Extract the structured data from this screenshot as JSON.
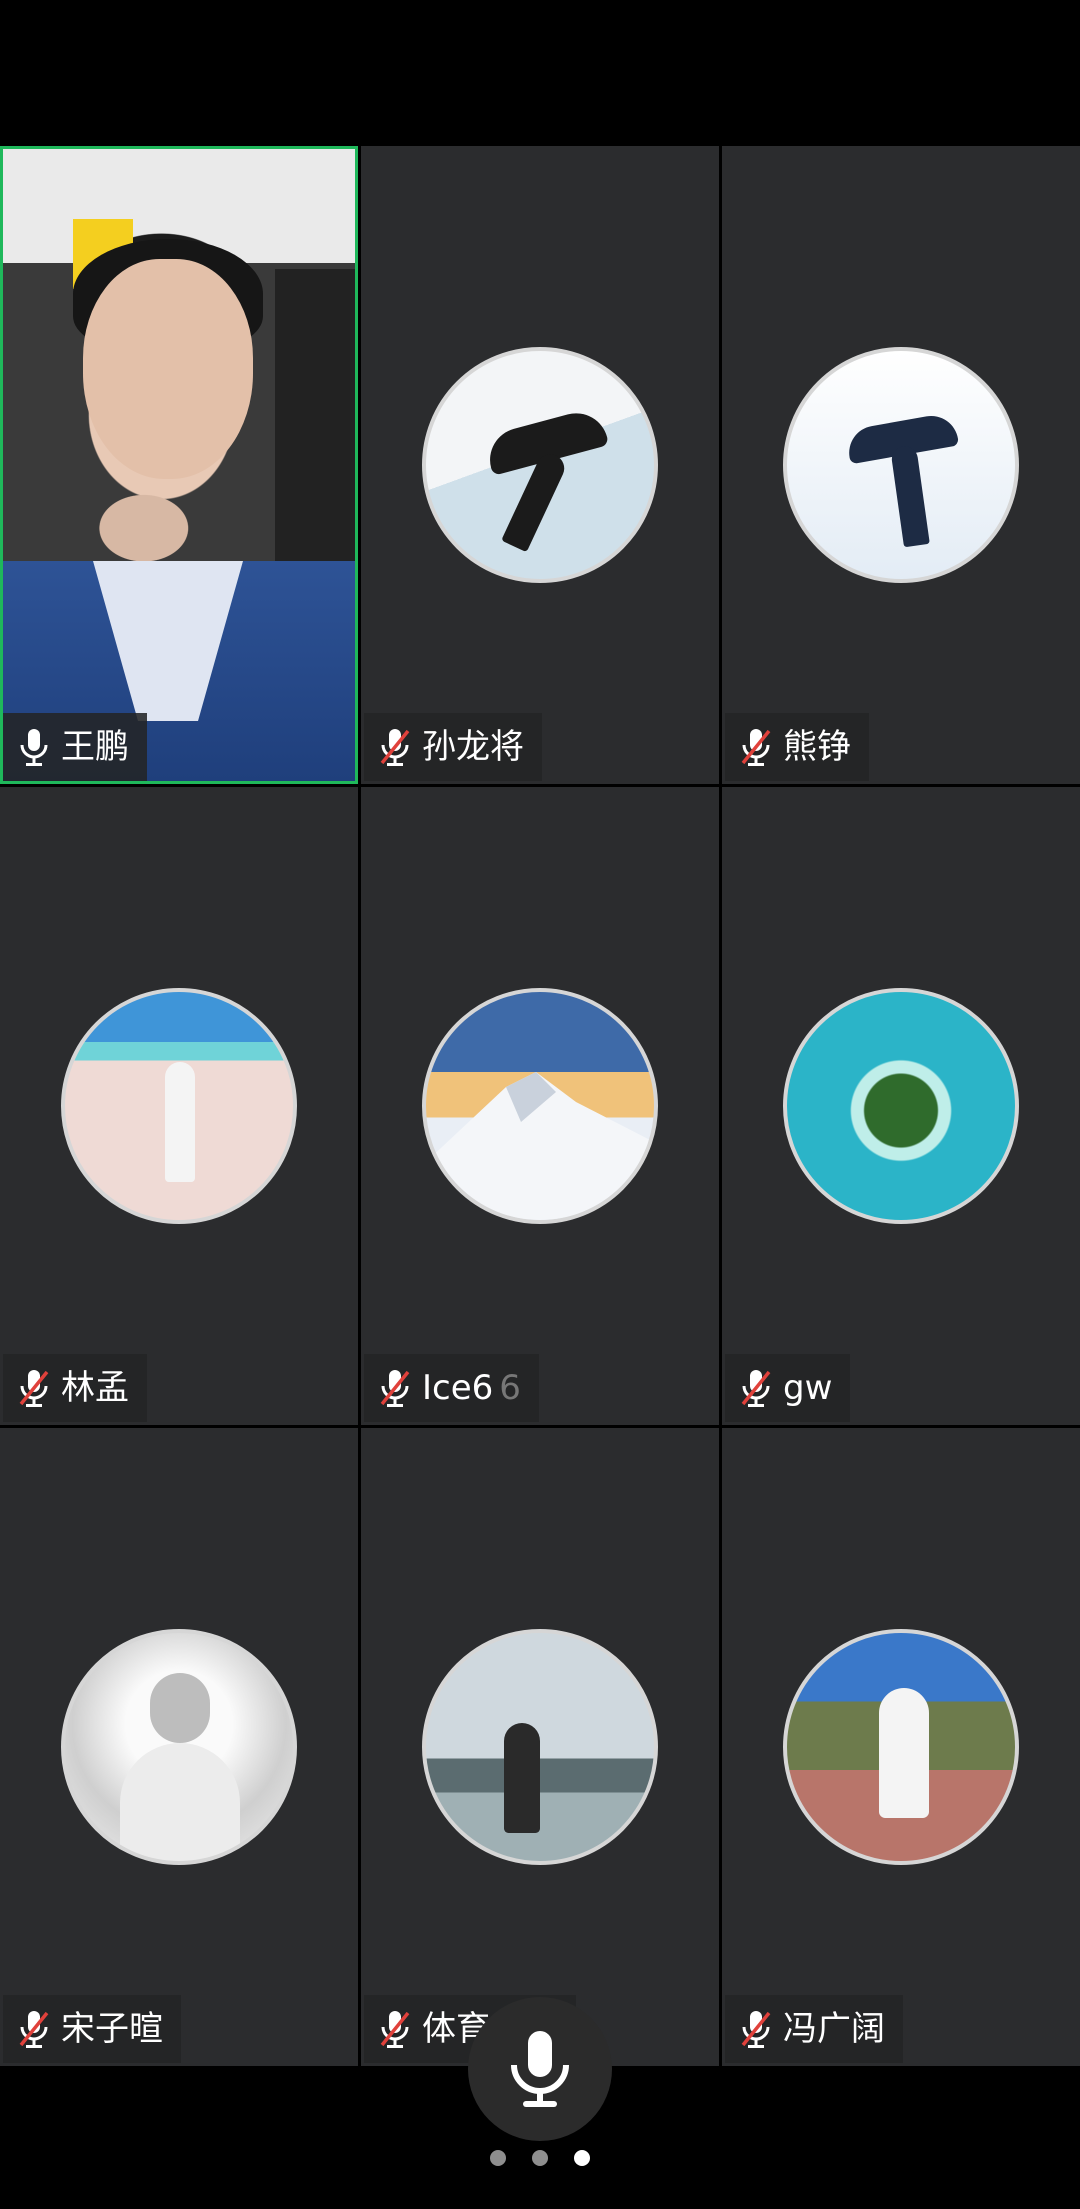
{
  "participants": [
    {
      "name": "王鹏",
      "muted": false,
      "video": true,
      "active": true
    },
    {
      "name": "孙龙将",
      "muted": true,
      "avatar": "speed-skater-avatar"
    },
    {
      "name": "熊铮",
      "muted": true,
      "avatar": "skater-avatar"
    },
    {
      "name": "林孟",
      "muted": true,
      "avatar": "beach-girl-avatar"
    },
    {
      "name": "Ice6",
      "suffix": "6",
      "muted": true,
      "avatar": "mountain-avatar"
    },
    {
      "name": "gw",
      "muted": true,
      "avatar": "heart-island-avatar"
    },
    {
      "name": "宋子暄",
      "muted": true,
      "avatar": "portrait-bw-avatar"
    },
    {
      "name": "体育黄迎",
      "muted": true,
      "avatar": "seaside-photographer-avatar"
    },
    {
      "name": "冯广阔",
      "muted": true,
      "avatar": "street-walker-avatar"
    }
  ],
  "colors": {
    "active_border": "#1fb85b",
    "tile_bg": "#2b2c2e",
    "mute_red": "#e0413b",
    "mic_white": "#ffffff"
  },
  "pager": {
    "pages": 3,
    "current": 3
  },
  "controls": {
    "mic_icon": "microphone-icon"
  }
}
